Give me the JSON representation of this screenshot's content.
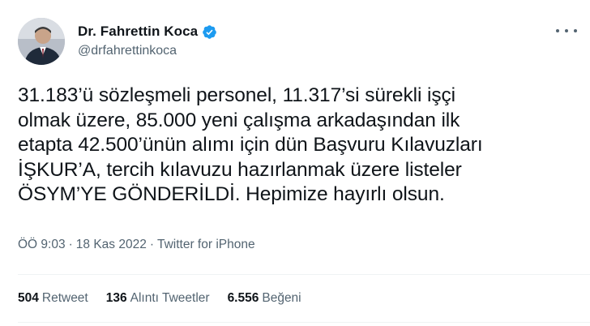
{
  "user": {
    "display_name": "Dr. Fahrettin Koca",
    "handle": "@drfahrettinkoca",
    "verified": true,
    "avatar_icon": "profile-photo"
  },
  "tweet": {
    "text": "31.183’ü sözleşmeli personel, 11.317’si sürekli işçi\nolmak üzere, 85.000 yeni çalışma arkadaşından ilk\netapta 42.500’ünün alımı için dün Başvuru Kılavuzları\nİŞKUR’A, tercih kılavuzu hazırlanmak üzere listeler\nÖSYM’YE GÖNDERİLDİ. Hepimize hayırlı olsun."
  },
  "meta": {
    "time": "ÖÖ 9:03",
    "separator1": "·",
    "date": "18 Kas 2022",
    "separator2": "·",
    "source": "Twitter for iPhone"
  },
  "stats": {
    "retweet_count": "504",
    "retweet_label": "Retweet",
    "quote_count": "136",
    "quote_label": "Alıntı Tweetler",
    "like_count": "6.556",
    "like_label": "Beğeni"
  },
  "colors": {
    "verified": "#1d9bf0",
    "secondary_text": "#536471",
    "primary_text": "#0f1419",
    "divider": "#eff3f4"
  },
  "icons": {
    "verified": "verified-badge-icon",
    "more": "more-horizontal-icon"
  }
}
